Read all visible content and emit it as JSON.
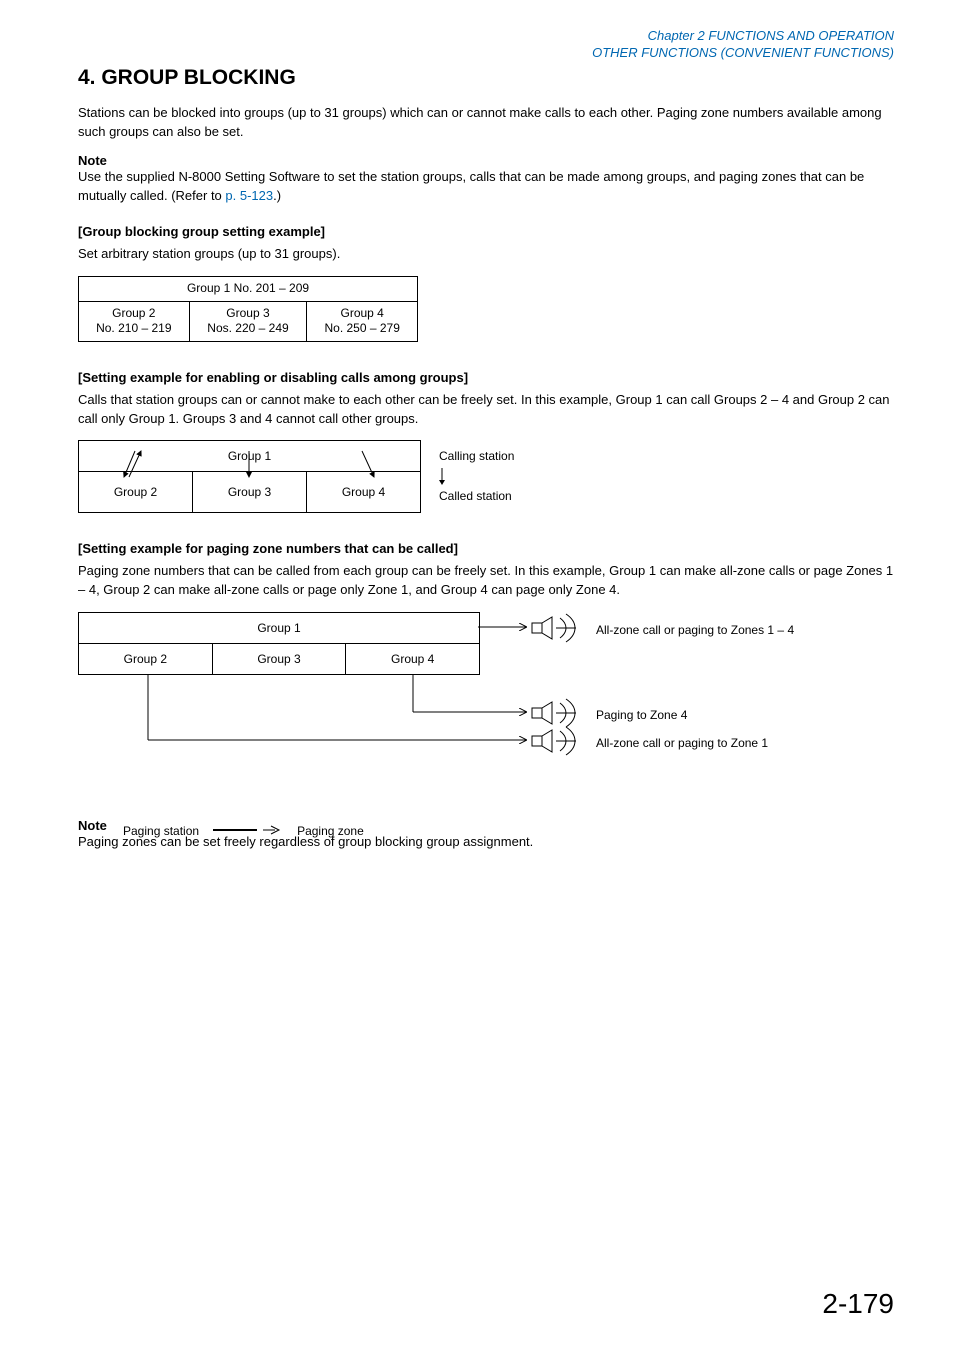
{
  "header": {
    "line1": "Chapter 2   FUNCTIONS AND OPERATION",
    "line2": "OTHER FUNCTIONS (CONVENIENT FUNCTIONS)"
  },
  "title": "4. GROUP BLOCKING",
  "intro": "Stations can be blocked into groups (up to 31 groups) which can or cannot make calls to each other. Paging zone numbers available among such groups can also be set.",
  "note1": {
    "label": "Note",
    "pre": "Use the supplied N-8000 Setting Software to set the station groups, calls that can be made among groups, and paging zones that can be mutually called. (Refer to ",
    "link": "p. 5-123",
    "post": ".)"
  },
  "sub1": {
    "heading": "[Group blocking group setting example]",
    "desc": "Set arbitrary station groups (up to 31 groups).",
    "table": {
      "merged": "Group 1   No. 201 – 209",
      "c1a": "Group 2",
      "c1b": "No. 210 – 219",
      "c2a": "Group 3",
      "c2b": "Nos. 220 – 249",
      "c3a": "Group 4",
      "c3b": "No. 250 – 279"
    }
  },
  "sub2": {
    "heading": "[Setting example for enabling or disabling calls among groups]",
    "desc": "Calls that station groups can or cannot make to each other can be freely set. In this example, Group 1 can call Groups 2 – 4 and Group 2 can call only Group 1. Groups 3 and 4 cannot call other groups.",
    "g1": "Group 1",
    "g2": "Group 2",
    "g3": "Group 3",
    "g4": "Group 4",
    "calling": "Calling station",
    "called": "Called station"
  },
  "sub3": {
    "heading": "[Setting example for paging zone numbers that can be called]",
    "desc": "Paging zone numbers that can be called from each group can be freely set. In this example, Group 1 can make all-zone calls or page Zones 1 – 4, Group 2 can make all-zone calls or page only Zone 1, and Group 4 can page only Zone 4.",
    "g1": "Group 1",
    "g2": "Group 2",
    "g3": "Group 3",
    "g4": "Group 4",
    "sp1": "All-zone call or paging to Zones 1 – 4",
    "sp2": "Paging to Zone 4",
    "sp3": "All-zone call or paging to Zone 1",
    "legend_station": "Paging station",
    "legend_zone": "Paging zone"
  },
  "note2": {
    "label": "Note",
    "text": "Paging zones can be set freely regardless of group blocking group assignment."
  },
  "pagenum": "2-179"
}
